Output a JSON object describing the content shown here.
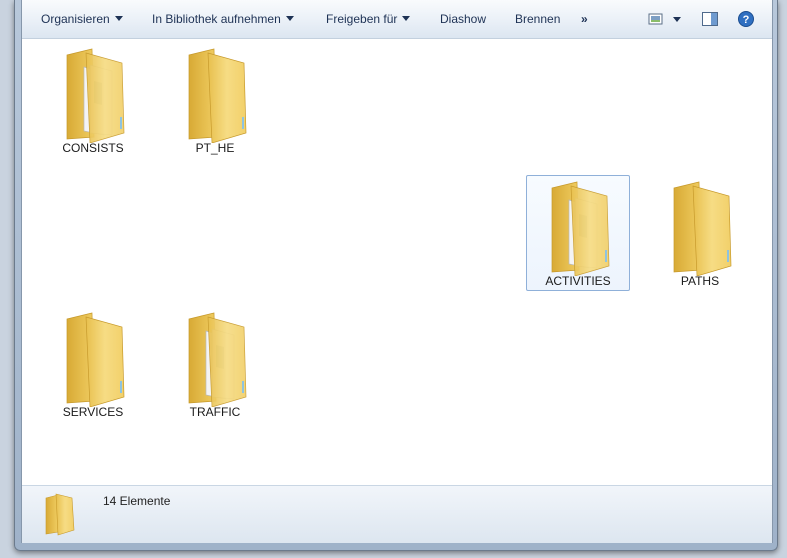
{
  "toolbar": {
    "organize": "Organisieren",
    "library": "In Bibliothek aufnehmen",
    "share": "Freigeben für",
    "slideshow": "Diashow",
    "burn": "Brennen",
    "more": "»"
  },
  "folders": [
    {
      "name": "CONSISTS",
      "icon": "folder-with-documents-icon"
    },
    {
      "name": "PT_HE",
      "icon": "folder-icon"
    },
    {
      "name": "ACTIVITIES",
      "icon": "folder-with-documents-icon",
      "selected": true
    },
    {
      "name": "PATHS",
      "icon": "folder-icon"
    },
    {
      "name": "SERVICES",
      "icon": "folder-icon"
    },
    {
      "name": "TRAFFIC",
      "icon": "folder-with-documents-icon"
    }
  ],
  "status": {
    "count": "14 Elemente"
  },
  "colors": {
    "toolbar_text": "#1e3255",
    "selection_border": "#8fb0d9",
    "folder_yellow": "#f3d46b"
  }
}
